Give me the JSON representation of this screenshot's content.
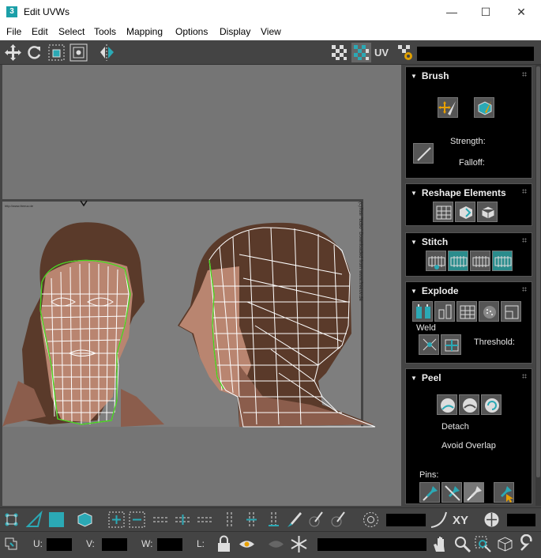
{
  "window": {
    "app_icon_text": "3",
    "title": "Edit UVWs",
    "minimize_glyph": "—",
    "maximize_glyph": "☐",
    "close_glyph": "✕"
  },
  "menu": [
    "File",
    "Edit",
    "Select",
    "Tools",
    "Mapping",
    "Options",
    "Display",
    "View"
  ],
  "toolbar": {
    "uv_label": "UV",
    "left_icons": [
      "move-icon",
      "rotate-icon",
      "scale-icon",
      "freeform-icon",
      "mirror-icon"
    ],
    "right_icons": [
      "checker-icon",
      "checker-uv-icon",
      "settings-checker-icon"
    ]
  },
  "viewport": {
    "background_color": "#757575",
    "texture_bg": "#7e7e7e",
    "wire_color": "#ffffff",
    "seam_color": "#45d61a",
    "side_caption": "(c)Tosi \"bcbo\" Downloaded from www.freeuv.de",
    "top_caption": "http://www.freeuv.de"
  },
  "panel": {
    "brush": {
      "title": "Brush",
      "strength_label": "Strength:",
      "falloff_label": "Falloff:"
    },
    "reshape": {
      "title": "Reshape Elements"
    },
    "stitch": {
      "title": "Stitch"
    },
    "explode": {
      "title": "Explode",
      "weld_label": "Weld",
      "threshold_label": "Threshold:"
    },
    "peel": {
      "title": "Peel",
      "detach_label": "Detach",
      "avoid_overlap_label": "Avoid Overlap",
      "pins_label": "Pins:"
    }
  },
  "bottom": {
    "u_label": "U:",
    "v_label": "V:",
    "w_label": "W:",
    "l_label": "L:",
    "xy_label": "XY",
    "accent": "#2ba9b5"
  }
}
